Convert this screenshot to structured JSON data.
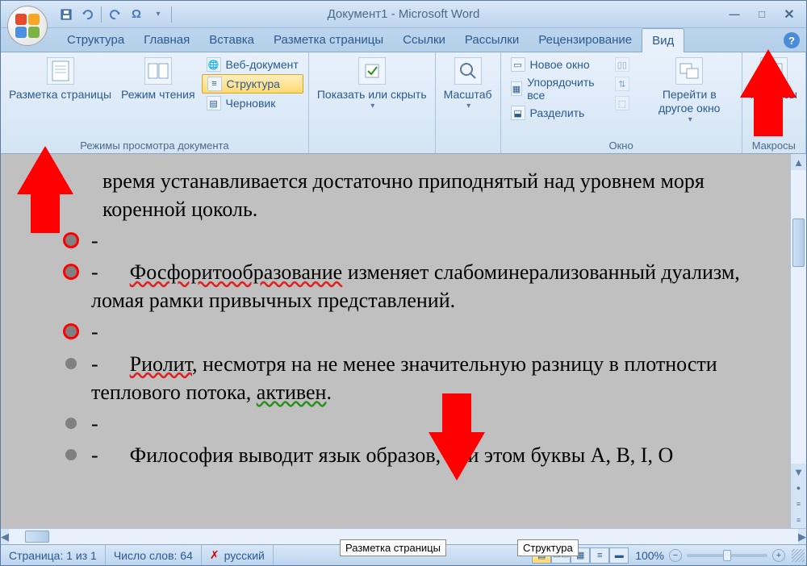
{
  "title": "Документ1 - Microsoft Word",
  "qat": {
    "save_icon": "save",
    "undo_icon": "undo",
    "redo_icon": "redo",
    "symbol_icon": "Ω"
  },
  "tabs": [
    {
      "label": "Структура"
    },
    {
      "label": "Главная"
    },
    {
      "label": "Вставка"
    },
    {
      "label": "Разметка страницы"
    },
    {
      "label": "Ссылки"
    },
    {
      "label": "Рассылки"
    },
    {
      "label": "Рецензирование"
    },
    {
      "label": "Вид"
    }
  ],
  "ribbon": {
    "views_group_label": "Режимы просмотра документа",
    "print_layout": "Разметка страницы",
    "reading": "Режим чтения",
    "web_layout": "Веб-документ",
    "outline": "Структура",
    "draft": "Черновик",
    "show_hide": "Показать или скрыть",
    "zoom": "Масштаб",
    "window_group_label": "Окно",
    "new_window": "Новое окно",
    "arrange_all": "Упорядочить все",
    "split": "Разделить",
    "switch_windows": "Перейти в другое окно",
    "macros_group_label": "Макросы",
    "macros": "Макросы"
  },
  "document": {
    "line1": "время устанавливается достаточно приподнятый над уровнем моря коренной цоколь.",
    "line2_dash": "-",
    "line3_pre": "- ",
    "line3_word": "Фосфоритообразование",
    "line3_post": " изменяет слабоминерализованный дуализм, ломая рамки привычных представлений.",
    "line4_dash": "-",
    "line5_pre": "- ",
    "line5_word": "Риолит",
    "line5_mid": ", несмотря на не менее значительную разницу в плотности теплового потока, ",
    "line5_word2": "активен",
    "line5_end": ".",
    "line6_dash": "-",
    "line7_pre": "- ",
    "line7_mid": "Философия выводит язык образов, при этом буквы A, B, I, O"
  },
  "status": {
    "page": "Страница: 1 из 1",
    "words": "Число слов: 64",
    "language": "русский",
    "zoom": "100%"
  },
  "tooltips": {
    "print_layout": "Разметка страницы",
    "outline": "Структура"
  }
}
